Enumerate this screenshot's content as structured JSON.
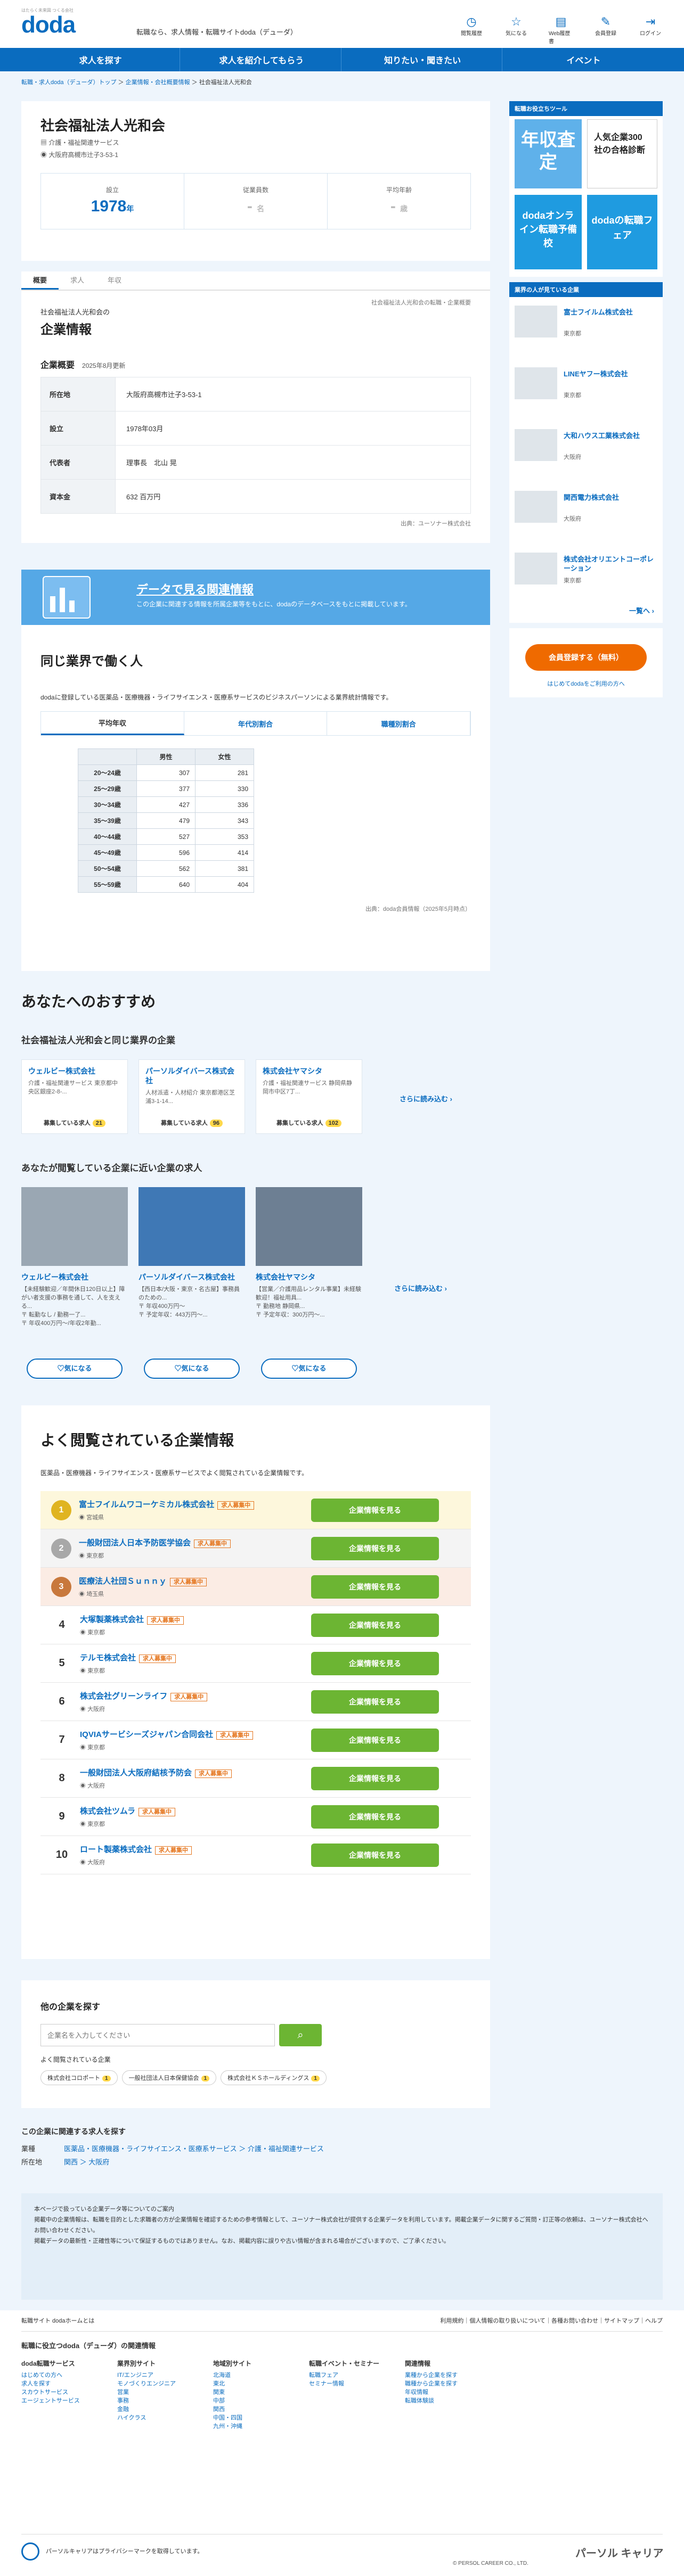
{
  "header": {
    "logo": "doda",
    "logo_sub": "はたらく未来図 つくる会社",
    "tagline": "転職なら、求人情報・転職サイトdoda（デューダ）",
    "icons": [
      {
        "name": "history-icon",
        "glyph": "◷",
        "label": "閲覧履歴"
      },
      {
        "name": "star-icon",
        "glyph": "☆",
        "label": "気になる"
      },
      {
        "name": "doc-icon",
        "glyph": "▤",
        "label": "Web履歴書"
      },
      {
        "name": "edit-icon",
        "glyph": "✎",
        "label": "会員登録"
      },
      {
        "name": "login-icon",
        "glyph": "⇥",
        "label": "ログイン"
      }
    ]
  },
  "gnav": [
    "求人を探す",
    "求人を紹介してもらう",
    "知りたい・聞きたい",
    "イベント"
  ],
  "breadcrumb": [
    "転職・求人doda（デューダ）トップ",
    "企業情報・会社概要情報",
    "社会福祉法人光和会"
  ],
  "company": {
    "name": "社会福祉法人光和会",
    "industry": "介護・福祉関連サービス",
    "address": "大阪府高槻市辻子3-53-1",
    "stats": [
      {
        "label": "設立",
        "value": "1978",
        "unit": "年"
      },
      {
        "label": "従業員数",
        "value": "-",
        "unit": "名"
      },
      {
        "label": "平均年齢",
        "value": "-",
        "unit": "歳"
      }
    ]
  },
  "tabs": [
    "概要",
    "求人",
    "年収"
  ],
  "info": {
    "note_right": "社会福祉法人光和会の転職・企業概要",
    "sub": "社会福祉法人光和会の",
    "title": "企業情報",
    "overview_title": "企業概要",
    "updated": "2025年8月更新",
    "rows": [
      {
        "k": "所在地",
        "v": "大阪府高槻市辻子3-53-1"
      },
      {
        "k": "設立",
        "v": "1978年03月"
      },
      {
        "k": "代表者",
        "v": "理事長　北山 晃"
      },
      {
        "k": "資本金",
        "v": "632 百万円"
      }
    ],
    "source": "出典：ユーソナー株式会社"
  },
  "banner": {
    "title": "データで見る関連情報",
    "text": "この企業に関連する情報を所属企業等をもとに、dodaのデータベースをもとに掲載しています。"
  },
  "industry": {
    "title": "同じ業界で働く人",
    "desc": "dodaに登録している医薬品・医療機器・ライフサイエンス・医療系サービスのビジネスパーソンによる業界統計情報です。",
    "tabs": [
      "平均年収",
      "年代別割合",
      "職種別割合"
    ],
    "head": [
      "",
      "男性",
      "女性"
    ],
    "rows": [
      [
        "20〜24歳",
        "307",
        "281"
      ],
      [
        "25〜29歳",
        "377",
        "330"
      ],
      [
        "30〜34歳",
        "427",
        "336"
      ],
      [
        "35〜39歳",
        "479",
        "343"
      ],
      [
        "40〜44歳",
        "527",
        "353"
      ],
      [
        "45〜49歳",
        "596",
        "414"
      ],
      [
        "50〜54歳",
        "562",
        "381"
      ],
      [
        "55〜59歳",
        "640",
        "404"
      ]
    ],
    "source": "出典：doda会員情報（2025年5月時点）"
  },
  "reco": {
    "title": "あなたへのおすすめ",
    "same_title": "社会福祉法人光和会と同じ業界の企業",
    "companies": [
      {
        "n": "ウェルビー株式会社",
        "s": "介護・福祉関連サービス 東京都中央区銀座2-8-...",
        "c": "募集している求人",
        "b": "21"
      },
      {
        "n": "パーソルダイバース株式会社",
        "s": "人材派遣・人材紹介 東京都港区芝浦3-1-14...",
        "c": "募集している求人",
        "b": "96"
      },
      {
        "n": "株式会社ヤマシタ",
        "s": "介護・福祉関連サービス 静岡県静岡市中区7丁...",
        "c": "募集している求人",
        "b": "102"
      }
    ],
    "more": "さらに読み込む",
    "viewed_title": "あなたが閲覧している企業に近い企業の求人",
    "jobs": [
      {
        "n": "ウェルビー株式会社",
        "s": "【未経験歓迎／年間休日120日以上】障がい者支援の事務を通して、人を支える...\n〒 転勤なし / 勤務一了...\n〒 年収400万円〜/年収2年勤...",
        "btn": "♡気になる"
      },
      {
        "n": "パーソルダイバース株式会社",
        "s": "【西日本/大阪・東京・名古屋】事務員のための...\n〒 年収400万円〜\n〒 予定年収：443万円〜...",
        "btn": "♡気になる"
      },
      {
        "n": "株式会社ヤマシタ",
        "s": "【営業／介護用品レンタル事業】未経験歓迎！福祉用具...\n〒 勤務地 静岡県...\n〒 予定年収：300万円〜...",
        "btn": "♡気になる"
      }
    ]
  },
  "ranking": {
    "title": "よく閲覧されている企業情報",
    "desc": "医薬品・医療機器・ライフサイエンス・医療系サービスでよく閲覧されている企業情報です。",
    "btn": "企業情報を見る",
    "tag": "求人募集中",
    "items": [
      {
        "n": "1",
        "name": "富士フイルムワコーケミカル株式会社",
        "loc": "宮城県"
      },
      {
        "n": "2",
        "name": "一般財団法人日本予防医学協会",
        "loc": "東京都"
      },
      {
        "n": "3",
        "name": "医療法人社団Ｓｕｎｎｙ",
        "loc": "埼玉県"
      },
      {
        "n": "4",
        "name": "大塚製薬株式会社",
        "loc": "東京都"
      },
      {
        "n": "5",
        "name": "テルモ株式会社",
        "loc": "東京都"
      },
      {
        "n": "6",
        "name": "株式会社グリーンライフ",
        "loc": "大阪府"
      },
      {
        "n": "7",
        "name": "IQVIAサービシーズジャパン合同会社",
        "loc": "東京都"
      },
      {
        "n": "8",
        "name": "一般財団法人大阪府結核予防会",
        "loc": "大阪府"
      },
      {
        "n": "9",
        "name": "株式会社ツムラ",
        "loc": "東京都"
      },
      {
        "n": "10",
        "name": "ロート製薬株式会社",
        "loc": "大阪府"
      }
    ]
  },
  "search": {
    "title": "他の企業を探す",
    "placeholder": "企業名を入力してください",
    "popular": "よく閲覧されている企業",
    "chips": [
      {
        "n": "株式会社コロポート",
        "b": "1"
      },
      {
        "n": "一般社団法人日本保健協会",
        "b": "1"
      },
      {
        "n": "株式会社ＫＳホールディングス",
        "b": "1"
      }
    ]
  },
  "related": {
    "title": "この企業に関連する求人を探す",
    "row1_k": "業種",
    "row1_v": "医薬品・医療機器・ライフサイエンス・医療系サービス ＞ 介護・福祉関連サービス",
    "row2_k": "所在地",
    "row2_v": "関西 ＞ 大阪府"
  },
  "notice": {
    "text": "本ページで扱っている企業データ等についてのご案内\n掲載中の企業情報は、転職を目的とした求職者の方が企業情報を確認するための参考情報として、ユーソナー株式会社が提供する企業データを利用しています。掲載企業データに関するご質問・訂正等の依頼は、ユーソナー株式会社へお問い合わせください。\n掲載データの最新性・正確性等について保証するものではありません。なお、掲載内容に誤りや古い情報が含まれる場合がございますので、ご了承ください。"
  },
  "sidebar": {
    "tool_title": "転職お役立ちツール",
    "ad1_big": "年収査定",
    "ad1_right": "人気企業300社の合格診断",
    "ad2": "dodaオンライン転職予備校",
    "ad2_right": "dodaの転職フェア",
    "companies_title": "業界の人が見ている企業",
    "cos": [
      {
        "n": "富士フイルム株式会社",
        "l": "東京都"
      },
      {
        "n": "LINEヤフー株式会社",
        "l": "東京都"
      },
      {
        "n": "大和ハウス工業株式会社",
        "l": "大阪府"
      },
      {
        "n": "関西電力株式会社",
        "l": "大阪府"
      },
      {
        "n": "株式会社オリエントコーポレーション",
        "l": "東京都"
      }
    ],
    "more": "一覧へ",
    "reg_btn": "会員登録する（無料）",
    "reg_sub": "はじめてdodaをご利用の方へ"
  },
  "footer": {
    "links": "転職サイト dodaホームとは",
    "nav": "利用規約｜個人情報の取り扱いについて｜各種お問い合わせ｜サイトマップ｜ヘルプ",
    "title": "転職に役立つdoda（デューダ）の関連情報",
    "cols": [
      {
        "h": "doda転職サービス",
        "items": [
          "はじめての方へ",
          "求人を探す",
          "スカウトサービス",
          "エージェントサービス"
        ]
      },
      {
        "h": "業界別サイト",
        "items": [
          "IT/エンジニア",
          "モノづくりエンジニア",
          "営業",
          "事務",
          "金融",
          "ハイクラス"
        ]
      },
      {
        "h": "地域別サイト",
        "items": [
          "北海道",
          "東北",
          "関東",
          "中部",
          "関西",
          "中国・四国",
          "九州・沖縄"
        ]
      },
      {
        "h": "転職イベント・セミナー",
        "items": [
          "転職フェア",
          "セミナー情報"
        ]
      },
      {
        "h": "関連情報",
        "items": [
          "業種から企業を探す",
          "職種から企業を探す",
          "年収情報",
          "転職体験談"
        ]
      }
    ],
    "persol_text": "パーソルキャリアはプライバシーマークを取得しています。",
    "copyright": "© PERSOL CAREER CO., LTD.",
    "brand": "パーソル キャリア"
  }
}
